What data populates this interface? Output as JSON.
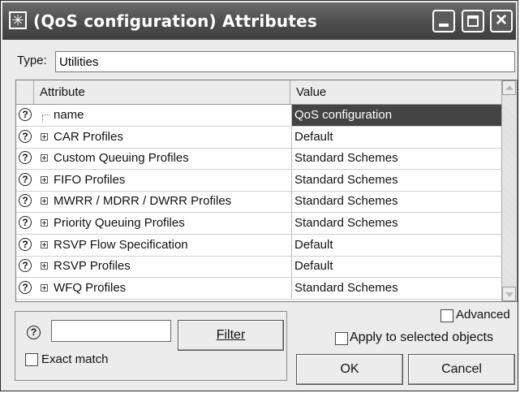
{
  "window": {
    "title": "(QoS configuration) Attributes",
    "icon": "asterisk-icon",
    "controls": [
      "minimize-icon",
      "maximize-icon",
      "close-icon"
    ]
  },
  "type_row": {
    "label": "Type:",
    "value": "Utilities"
  },
  "table": {
    "columns": [
      "Attribute",
      "Value"
    ],
    "rows": [
      {
        "attribute": "name",
        "value": "QoS configuration",
        "expandable": false,
        "selected": true
      },
      {
        "attribute": "CAR Profiles",
        "value": "Default",
        "expandable": true
      },
      {
        "attribute": "Custom Queuing Profiles",
        "value": "Standard Schemes",
        "expandable": true
      },
      {
        "attribute": "FIFO Profiles",
        "value": "Standard Schemes",
        "expandable": true
      },
      {
        "attribute": "MWRR / MDRR / DWRR Profiles",
        "value": "Standard Schemes",
        "expandable": true
      },
      {
        "attribute": "Priority Queuing Profiles",
        "value": "Standard Schemes",
        "expandable": true
      },
      {
        "attribute": "RSVP Flow Specification",
        "value": "Default",
        "expandable": true
      },
      {
        "attribute": "RSVP Profiles",
        "value": "Default",
        "expandable": true
      },
      {
        "attribute": "WFQ Profiles",
        "value": "Standard Schemes",
        "expandable": true
      }
    ]
  },
  "filter": {
    "input_value": "",
    "button_label": "Filter",
    "exact_match_label": "Exact match",
    "exact_match_checked": false
  },
  "options": {
    "advanced_label": "Advanced",
    "advanced_checked": false,
    "apply_label": "Apply to selected objects",
    "apply_checked": false
  },
  "buttons": {
    "ok": "OK",
    "cancel": "Cancel"
  },
  "colors": {
    "title_bar": "#4d4d4d",
    "selection": "#444444"
  }
}
